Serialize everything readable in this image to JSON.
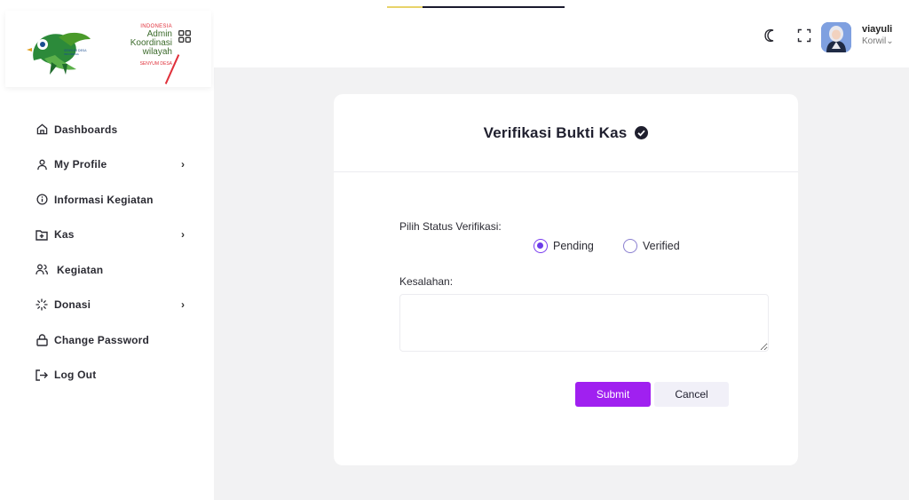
{
  "app": {
    "logo_top": "INDONESIA",
    "logo_title_1": "Admin",
    "logo_title_2": "Koordinasi",
    "logo_title_3": "wilayah",
    "logo_tagline": "SENYUM DESA"
  },
  "sidebar": {
    "items": [
      {
        "label": "Dashboards",
        "icon": "home-icon",
        "has_chevron": false
      },
      {
        "label": "My Profile",
        "icon": "user-icon",
        "has_chevron": true
      },
      {
        "label": "Informasi Kegiatan",
        "icon": "info-icon",
        "has_chevron": false
      },
      {
        "label": "Kas",
        "icon": "folder-plus-icon",
        "has_chevron": true
      },
      {
        "label": "Kegiatan",
        "icon": "users-icon",
        "has_chevron": false
      },
      {
        "label": "Donasi",
        "icon": "loader-icon",
        "has_chevron": true
      },
      {
        "label": "Change Password",
        "icon": "lock-icon",
        "has_chevron": false
      },
      {
        "label": "Log Out",
        "icon": "logout-icon",
        "has_chevron": false
      }
    ],
    "chevron": "›"
  },
  "header": {
    "user_name": "viayuli",
    "user_role": "Korwil",
    "role_caret": "⌄"
  },
  "form": {
    "title": "Verifikasi Bukti Kas",
    "status_label": "Pilih Status Verifikasi:",
    "options": [
      {
        "label": "Pending",
        "checked": true
      },
      {
        "label": "Verified",
        "checked": false
      }
    ],
    "error_label": "Kesalahan:",
    "error_value": "",
    "submit_label": "Submit",
    "cancel_label": "Cancel"
  },
  "colors": {
    "accent": "#a020f0",
    "radio": "#6c3ce8",
    "page_bg": "#f2f2f3"
  }
}
